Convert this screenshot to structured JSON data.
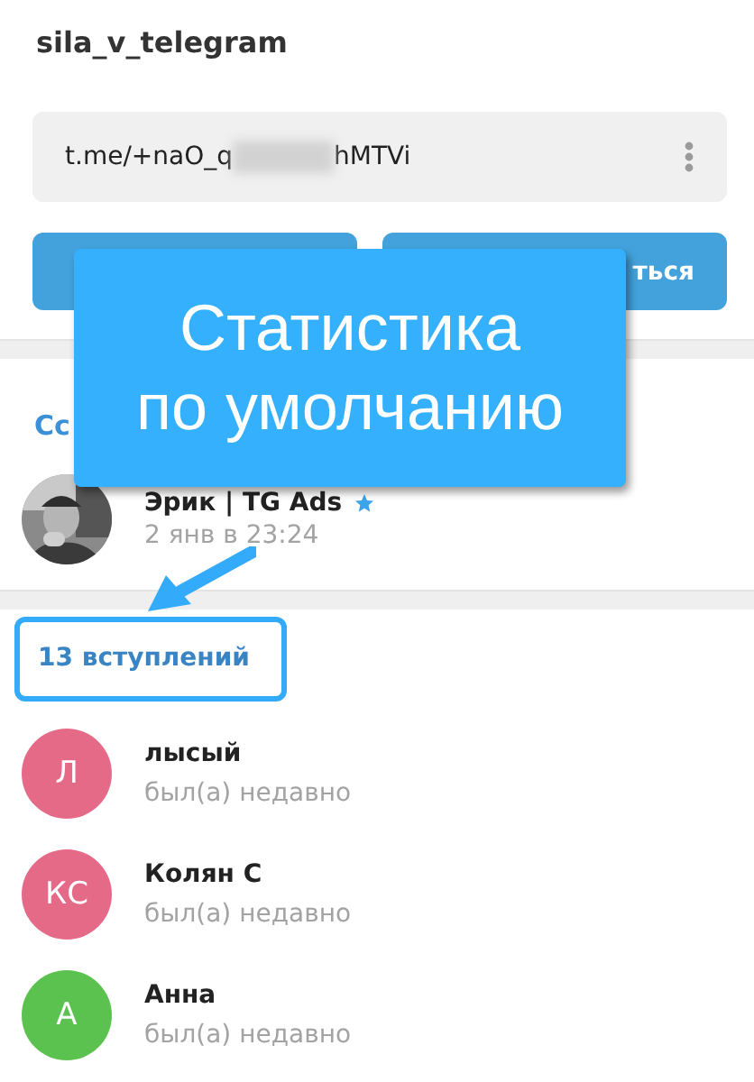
{
  "header": {
    "title": "sila_v_telegram"
  },
  "invite_link": {
    "link_start": "t.me/+naO_q",
    "link_end": "hMTVi",
    "redacted": true
  },
  "buttons": [
    {
      "label": "ться"
    }
  ],
  "creator_section": {
    "label": "Сс",
    "creator": {
      "name": "Эрик | TG Ads",
      "verified": true,
      "date": "2 янв в 23:24"
    }
  },
  "joins": {
    "title": "13 вступлений",
    "highlighted": true,
    "members": [
      {
        "initials": "Л",
        "name": "лысый",
        "status": "был(а) недавно",
        "color": "#e56a88"
      },
      {
        "initials": "КС",
        "name": "Колян С",
        "status": "был(а) недавно",
        "color": "#e56a88"
      },
      {
        "initials": "А",
        "name": "Анна",
        "status": "был(а) недавно",
        "color": "#5cc24f"
      }
    ]
  },
  "callout": {
    "lines": [
      "Статистика",
      "по умолчанию"
    ],
    "arrow": true
  }
}
